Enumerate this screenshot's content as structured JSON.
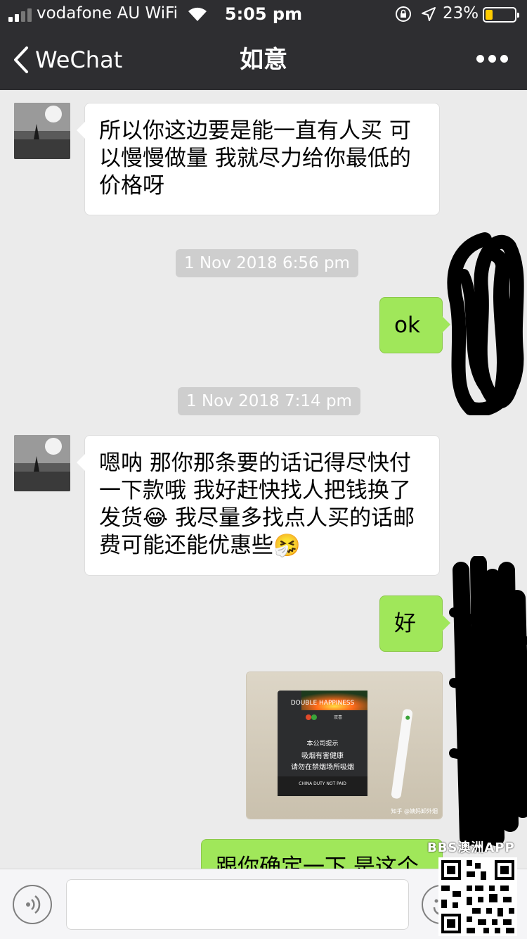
{
  "status_bar": {
    "carrier": "vodafone AU WiFi",
    "time": "5:05 pm",
    "battery_percent": "23%",
    "battery_level": 0.23,
    "battery_color": "#ffcc00"
  },
  "nav": {
    "back_label": "WeChat",
    "title": "如意"
  },
  "messages": [
    {
      "sender": "contact",
      "text": "所以你这边要是能一直有人买 可以慢慢做量 我就尽力给你最低的价格呀"
    },
    {
      "timestamp": "1 Nov 2018 6:56 pm"
    },
    {
      "sender": "me",
      "text": "ok"
    },
    {
      "timestamp": "1 Nov 2018 7:14 pm"
    },
    {
      "sender": "contact",
      "text": "嗯呐 那你那条要的话记得尽快付一下款哦 我好赶快找人把钱换了发货😂 我尽量多找点人买的话邮费可能还能优惠些🤧"
    },
    {
      "sender": "me",
      "text": "好"
    },
    {
      "sender": "me",
      "image": {
        "brand": "DOUBLE HAPPINESS",
        "pack_sub": "双喜",
        "warning_title": "本公司提示",
        "warning_line1": "吸烟有害健康",
        "warning_line2": "请勿在禁烟场所吸烟",
        "duty_text": "CHINA DUTY NOT PAID",
        "credit": "知乎 @姨妈卸外烟"
      }
    },
    {
      "sender": "me",
      "text": "跟你确定一下 是这个"
    }
  ],
  "colors": {
    "nav_bg": "#2e2e31",
    "chat_bg": "#ebebeb",
    "out_bubble": "#a0e75a",
    "in_bubble": "#ffffff"
  },
  "watermark": "BBS澳洲APP"
}
